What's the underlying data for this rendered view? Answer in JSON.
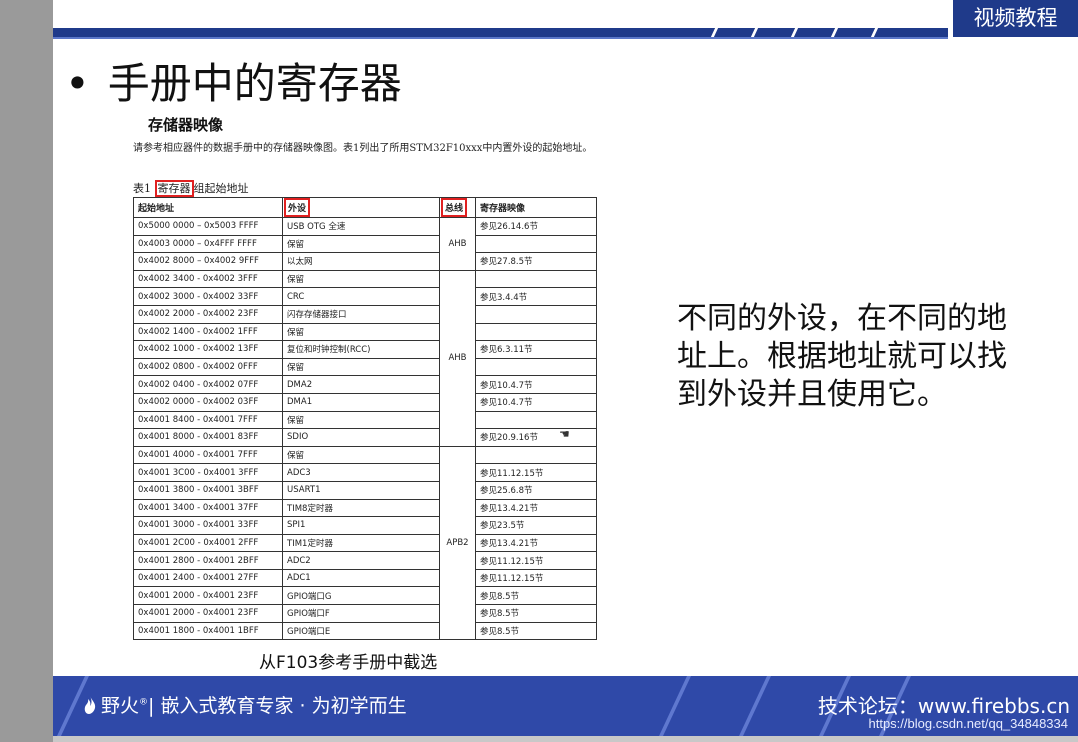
{
  "header": {
    "badge_label": "视频教程"
  },
  "slide": {
    "bullet": "•",
    "title": "手册中的寄存器"
  },
  "document": {
    "heading": "存储器映像",
    "intro": "请参考相应器件的数据手册中的存储器映像图。表1列出了所用STM32F10xxx中内置外设的起始地址。",
    "caption_prefix": "表1",
    "caption_highlight": "寄存器",
    "caption_suffix": "组起始地址",
    "columns": [
      "起始地址",
      "外设",
      "总线",
      "寄存器映像"
    ],
    "rows": [
      [
        "0x5000 0000 – 0x5003 FFFF",
        "USB OTG 全速",
        "参见26.14.6节"
      ],
      [
        "0x4003 0000 – 0x4FFF FFFF",
        "保留",
        ""
      ],
      [
        "0x4002 8000 – 0x4002 9FFF",
        "以太网",
        "参见27.8.5节"
      ],
      [
        "0x4002 3400 - 0x4002 3FFF",
        "保留",
        ""
      ],
      [
        "0x4002 3000 - 0x4002 33FF",
        "CRC",
        "参见3.4.4节"
      ],
      [
        "0x4002 2000 - 0x4002 23FF",
        "闪存存储器接口",
        ""
      ],
      [
        "0x4002 1400 - 0x4002 1FFF",
        "保留",
        ""
      ],
      [
        "0x4002 1000 - 0x4002 13FF",
        "复位和时钟控制(RCC)",
        "参见6.3.11节"
      ],
      [
        "0x4002 0800 - 0x4002 0FFF",
        "保留",
        ""
      ],
      [
        "0x4002 0400 - 0x4002 07FF",
        "DMA2",
        "参见10.4.7节"
      ],
      [
        "0x4002 0000 - 0x4002 03FF",
        "DMA1",
        "参见10.4.7节"
      ],
      [
        "0x4001 8400 - 0x4001 7FFF",
        "保留",
        ""
      ],
      [
        "0x4001 8000 - 0x4001 83FF",
        "SDIO",
        "参见20.9.16节"
      ],
      [
        "0x4001 4000 - 0x4001 7FFF",
        "保留",
        ""
      ],
      [
        "0x4001 3C00 - 0x4001 3FFF",
        "ADC3",
        "参见11.12.15节"
      ],
      [
        "0x4001 3800 - 0x4001 3BFF",
        "USART1",
        "参见25.6.8节"
      ],
      [
        "0x4001 3400 - 0x4001 37FF",
        "TIM8定时器",
        "参见13.4.21节"
      ],
      [
        "0x4001 3000 - 0x4001 33FF",
        "SPI1",
        "参见23.5节"
      ],
      [
        "0x4001 2C00 - 0x4001 2FFF",
        "TIM1定时器",
        "参见13.4.21节"
      ],
      [
        "0x4001 2800 - 0x4001 2BFF",
        "ADC2",
        "参见11.12.15节"
      ],
      [
        "0x4001 2400 - 0x4001 27FF",
        "ADC1",
        "参见11.12.15节"
      ],
      [
        "0x4001 2000 - 0x4001 23FF",
        "GPIO端口G",
        "参见8.5节"
      ],
      [
        "0x4001 2000 - 0x4001 23FF",
        "GPIO端口F",
        "参见8.5节"
      ],
      [
        "0x4001 1800 - 0x4001 1BFF",
        "GPIO端口E",
        "参见8.5节"
      ]
    ],
    "bus_groups": [
      {
        "label": "AHB",
        "start": 0,
        "span": 3
      },
      {
        "label": "AHB",
        "start": 3,
        "span": 10
      },
      {
        "label": "APB2",
        "start": 13,
        "span": 11
      }
    ],
    "source": "从F103参考手册中截选"
  },
  "note": {
    "text": "不同的外设，在不同的地址上。根据地址就可以找到外设并且使用它。"
  },
  "footer": {
    "brand": "野火",
    "brand_mark": "®",
    "tagline": "| 嵌入式教育专家 · 为初学而生",
    "forum": "技术论坛：www.firebbs.cn",
    "url": "https://blog.csdn.net/qq_34848334"
  },
  "colors": {
    "primary_blue": "#1f3a8a",
    "footer_blue": "#2f49a8",
    "highlight_red": "#e02020"
  }
}
